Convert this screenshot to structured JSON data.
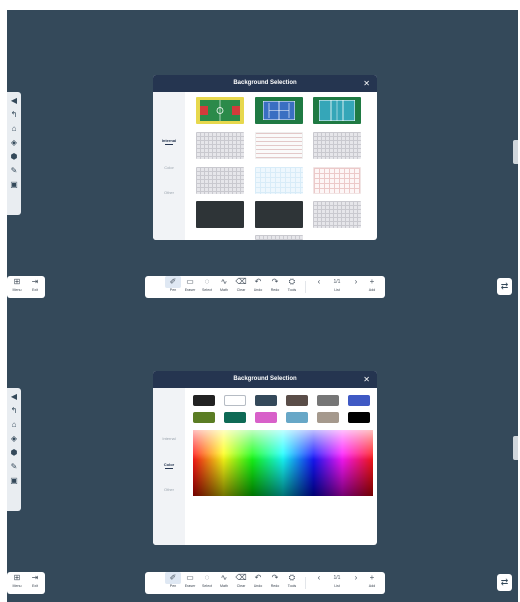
{
  "colors": {
    "screen": "#34495a",
    "dialog_header": "#253550",
    "accent": "#253550"
  },
  "dialog": {
    "title": "Background Selection",
    "close_icon": "close-icon"
  },
  "tabs": {
    "internal": "Internal",
    "color": "Color",
    "other": "Other"
  },
  "left_toolbar": {
    "icons": [
      "collapse-arrow-icon",
      "back-icon",
      "home-icon",
      "layers-icon",
      "shield-icon",
      "edit-icon",
      "box-icon"
    ]
  },
  "bottom_left": {
    "menu": "Menu",
    "exit": "Exit"
  },
  "toolbar": {
    "pen": "Pen",
    "eraser": "Eraser",
    "select": "Select",
    "math": "Math",
    "clear": "Clear",
    "undo": "Undo",
    "redo": "Redo",
    "tools": "Tools",
    "page": "1/1",
    "list": "List",
    "add": "Add"
  },
  "backgrounds": [
    "basketball-court",
    "tennis-court",
    "volleyball-court",
    "grid-gray",
    "lined-red",
    "grid-gray",
    "grid-gray",
    "grid-light-blue",
    "grid-red",
    "dark-board",
    "dark-board",
    "grid-gray"
  ],
  "swatches": [
    "#222222",
    "#ffffff",
    "#34495a",
    "#5a4d48",
    "#767676",
    "#3f59c4",
    "#5b7d24",
    "#0e6a55",
    "#d860c9",
    "#67a7c7",
    "#a5998d",
    "#000000"
  ]
}
